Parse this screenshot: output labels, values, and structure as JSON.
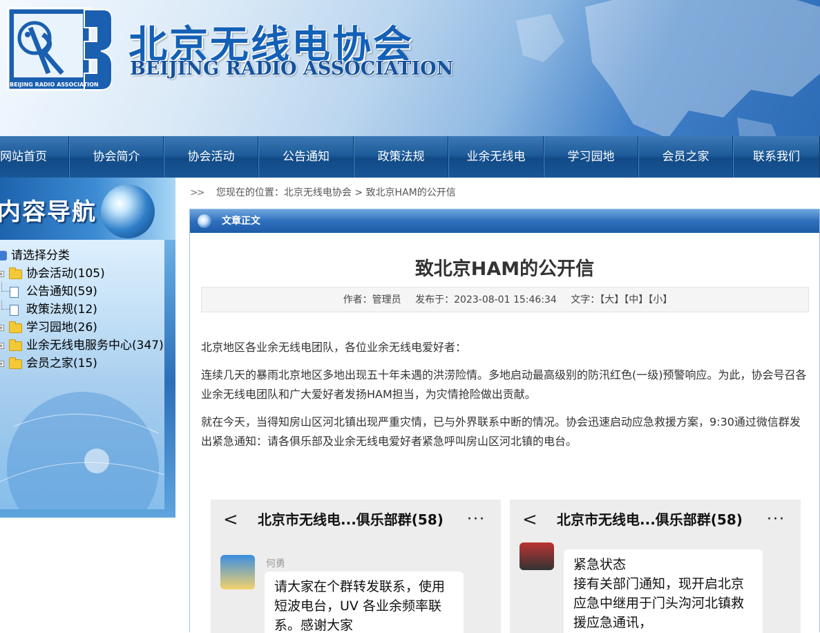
{
  "header": {
    "title_cn": "北京无线电协会",
    "title_en": "BEIJING RADIO ASSOCIATION",
    "logo_text": "BEIJING RADIO ASSOCIATION"
  },
  "nav": {
    "items": [
      "网站首页",
      "协会简介",
      "协会活动",
      "公告通知",
      "政策法规",
      "业余无线电",
      "学习园地",
      "会员之家",
      "联系我们"
    ]
  },
  "sidebar": {
    "title": "内容导航",
    "root_label": "请选择分类",
    "items": [
      {
        "label": "协会活动(105)",
        "icon": "folder-icon"
      },
      {
        "label": "公告通知(59)",
        "icon": "document-icon"
      },
      {
        "label": "政策法规(12)",
        "icon": "document-icon"
      },
      {
        "label": "学习园地(26)",
        "icon": "folder-icon"
      },
      {
        "label": "业余无线电服务中心(347)",
        "icon": "folder-icon"
      },
      {
        "label": "会员之家(15)",
        "icon": "folder-icon"
      }
    ]
  },
  "breadcrumb": {
    "arrows": ">>",
    "text": "您现在的位置：北京无线电协会 > 致北京HAM的公开信"
  },
  "panel": {
    "header": "文章正文"
  },
  "article": {
    "title": "致北京HAM的公开信",
    "author": "作者：管理员",
    "published": "发布于：2023-08-01 15:46:34",
    "size_label": "文字：",
    "size_large": "【大】",
    "size_medium": "【中】",
    "size_small": "【小】",
    "paragraphs": [
      "北京地区各业余无线电团队，各位业余无线电爱好者：",
      "连续几天的暴雨北京地区多地出现五十年未遇的洪涝险情。多地启动最高级别的防汛红色(一级)预警响应。为此，协会号召各业余无线电团队和广大爱好者发扬HAM担当，为灾情抢险做出贡献。",
      "就在今天，当得知房山区河北镇出现严重灾情，已与外界联系中断的情况。协会迅速启动应急救援方案，9:30通过微信群发出紧急通知：请各俱乐部及业余无线电爱好者紧急呼叫房山区河北镇的电台。"
    ]
  },
  "screenshots": [
    {
      "back": "<",
      "title": "北京市无线电...俱乐部群(58)",
      "more": "···",
      "sender": "何勇",
      "message": "请大家在个群转发联系，使用短波电台，UV 各业余频率联系。感谢大家"
    },
    {
      "back": "<",
      "title": "北京市无线电...俱乐部群(58)",
      "more": "···",
      "message": "紧急状态\n接有关部门通知，现开启北京应急中继用于门头沟河北镇救援应急通讯，"
    }
  ],
  "colors": {
    "nav_bg": "#1d5b9a",
    "title_blue": "#1460b6",
    "panel_head": "#2f6fbc"
  }
}
